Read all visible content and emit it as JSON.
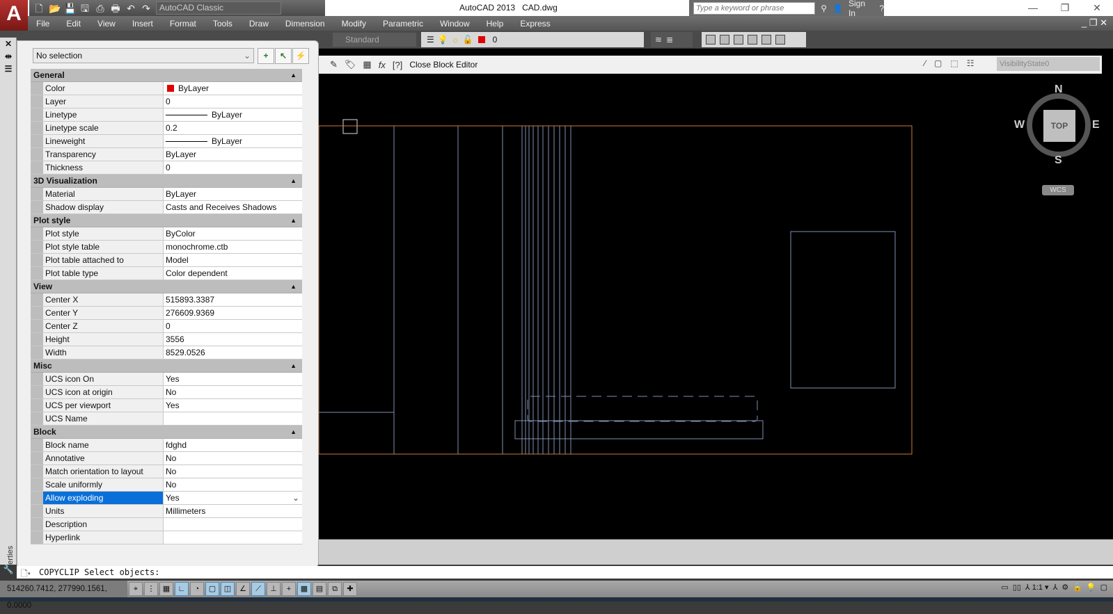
{
  "window": {
    "app_title": "AutoCAD 2013",
    "file": "CAD.dwg",
    "workspace": "AutoCAD Classic",
    "search_placeholder": "Type a keyword or phrase",
    "sign_in": "Sign In"
  },
  "menu": [
    "File",
    "Edit",
    "View",
    "Insert",
    "Format",
    "Tools",
    "Draw",
    "Dimension",
    "Modify",
    "Parametric",
    "Window",
    "Help",
    "Express"
  ],
  "toolbar": {
    "style": "Standard",
    "layer": "0"
  },
  "block_editor": {
    "close_label": "Close Block Editor",
    "visibility_state": "VisibilityState0"
  },
  "viewcube": {
    "n": "N",
    "s": "S",
    "e": "E",
    "w": "W",
    "face": "TOP",
    "wcs": "WCS"
  },
  "properties": {
    "panel_title": "Properties",
    "selection": "No selection",
    "sections": [
      {
        "title": "General",
        "rows": [
          [
            "Color",
            "ByLayer"
          ],
          [
            "Layer",
            "0"
          ],
          [
            "Linetype",
            "ByLayer"
          ],
          [
            "Linetype scale",
            "0.2"
          ],
          [
            "Lineweight",
            "ByLayer"
          ],
          [
            "Transparency",
            "ByLayer"
          ],
          [
            "Thickness",
            "0"
          ]
        ]
      },
      {
        "title": "3D Visualization",
        "rows": [
          [
            "Material",
            "ByLayer"
          ],
          [
            "Shadow display",
            "Casts and Receives Shadows"
          ]
        ]
      },
      {
        "title": "Plot style",
        "rows": [
          [
            "Plot style",
            "ByColor"
          ],
          [
            "Plot style table",
            "monochrome.ctb"
          ],
          [
            "Plot table attached to",
            "Model"
          ],
          [
            "Plot table type",
            "Color dependent"
          ]
        ]
      },
      {
        "title": "View",
        "rows": [
          [
            "Center X",
            "515893.3387"
          ],
          [
            "Center Y",
            "276609.9369"
          ],
          [
            "Center Z",
            "0"
          ],
          [
            "Height",
            "3556"
          ],
          [
            "Width",
            "8529.0526"
          ]
        ]
      },
      {
        "title": "Misc",
        "rows": [
          [
            "UCS icon On",
            "Yes"
          ],
          [
            "UCS icon at origin",
            "No"
          ],
          [
            "UCS per viewport",
            "Yes"
          ],
          [
            "UCS Name",
            ""
          ]
        ]
      },
      {
        "title": "Block",
        "rows": [
          [
            "Block name",
            "fdghd"
          ],
          [
            "Annotative",
            "No"
          ],
          [
            "Match orientation to layout",
            "No"
          ],
          [
            "Scale uniformly",
            "No"
          ],
          [
            "Allow exploding",
            "Yes"
          ],
          [
            "Units",
            "Millimeters"
          ],
          [
            "Description",
            ""
          ],
          [
            "Hyperlink",
            ""
          ]
        ]
      }
    ]
  },
  "command": "COPYCLIP Select objects:",
  "status": {
    "coords": "514260.7412, 277990.1561, 0.0000",
    "annoscale": "1:1"
  },
  "colors": {
    "accent": "#0a6fd8",
    "bylayer_swatch": "#e00000",
    "block_boundary": "#d07a30",
    "geometry": "#8090b0"
  }
}
